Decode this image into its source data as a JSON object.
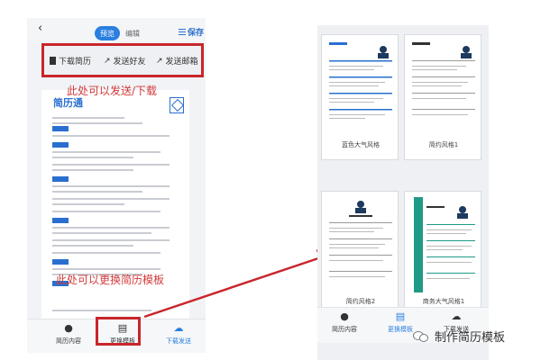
{
  "left_phone": {
    "tabs": {
      "preview": "预览",
      "edit": "编辑"
    },
    "save_label": "保存",
    "actions": [
      "下载简历",
      "发送好友",
      "发送邮箱"
    ],
    "resume_title": "简历通",
    "annotation_send": "此处可以发送/下载",
    "annotation_template": "此处可以更换简历模板",
    "bottom_nav": [
      "简历内容",
      "更换模板",
      "下载发送"
    ]
  },
  "right_phone": {
    "templates": [
      "蓝色大气风格",
      "简约风格1",
      "简约风格2",
      "商务大气风格1"
    ],
    "bottom_nav": [
      "简历内容",
      "更换模板",
      "下载发送"
    ]
  },
  "watermark": "制作简历模板",
  "colors": {
    "accent": "#2a7fe0",
    "highlight_red": "#c8262b",
    "annotation_red": "#d23a3a",
    "teal": "#1f9a87"
  }
}
